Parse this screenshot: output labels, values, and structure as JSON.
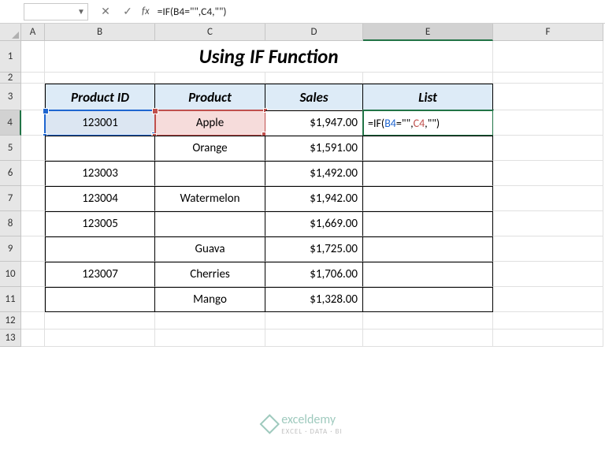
{
  "namebox": "",
  "fx_label": "fx",
  "formula_bar": "=IF(B4=\"\",C4,\"\")",
  "columns": [
    "A",
    "B",
    "C",
    "D",
    "E",
    "F"
  ],
  "title": "Using IF Function",
  "headers": {
    "b": "Product ID",
    "c": "Product",
    "d": "Sales",
    "e": "List"
  },
  "rows": [
    {
      "id": "123001",
      "product": "Apple",
      "sales": "$1,947.00"
    },
    {
      "id": "",
      "product": "Orange",
      "sales": "$1,591.00"
    },
    {
      "id": "123003",
      "product": "",
      "sales": "$1,492.00"
    },
    {
      "id": "123004",
      "product": "Watermelon",
      "sales": "$1,942.00"
    },
    {
      "id": "123005",
      "product": "",
      "sales": "$1,669.00"
    },
    {
      "id": "",
      "product": "Guava",
      "sales": "$1,725.00"
    },
    {
      "id": "123007",
      "product": "Cherries",
      "sales": "$1,706.00"
    },
    {
      "id": "",
      "product": "Mango",
      "sales": "$1,328.00"
    }
  ],
  "cell_formula": {
    "pre": "=IF(",
    "ref1": "B4",
    "mid1": "=\"\",",
    "ref2": "C4",
    "post": ",\"\")"
  },
  "watermark": {
    "name": "exceldemy",
    "sub": "EXCEL · DATA · BI"
  },
  "chart_data": {
    "type": "table",
    "columns": [
      "Product ID",
      "Product",
      "Sales",
      "List"
    ],
    "rows": [
      [
        "123001",
        "Apple",
        "$1,947.00",
        "=IF(B4=\"\",C4,\"\")"
      ],
      [
        "",
        "Orange",
        "$1,591.00",
        ""
      ],
      [
        "123003",
        "",
        "$1,492.00",
        ""
      ],
      [
        "123004",
        "Watermelon",
        "$1,942.00",
        ""
      ],
      [
        "123005",
        "",
        "$1,669.00",
        ""
      ],
      [
        "",
        "Guava",
        "$1,725.00",
        ""
      ],
      [
        "123007",
        "Cherries",
        "$1,706.00",
        ""
      ],
      [
        "",
        "Mango",
        "$1,328.00",
        ""
      ]
    ],
    "title": "Using IF Function"
  }
}
